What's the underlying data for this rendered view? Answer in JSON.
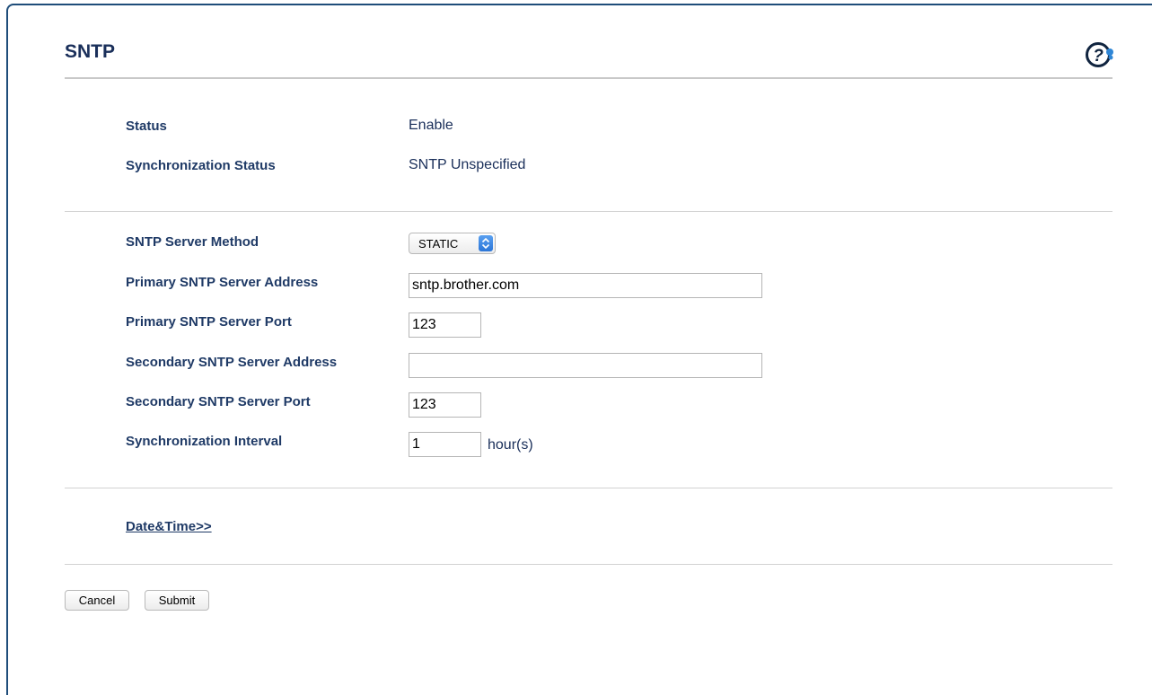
{
  "page": {
    "title": "SNTP"
  },
  "status_section": {
    "status_label": "Status",
    "status_value": "Enable",
    "sync_status_label": "Synchronization Status",
    "sync_status_value": "SNTP Unspecified"
  },
  "settings": {
    "server_method_label": "SNTP Server Method",
    "server_method_value": "STATIC",
    "primary_address_label": "Primary SNTP Server Address",
    "primary_address_value": "sntp.brother.com",
    "primary_port_label": "Primary SNTP Server Port",
    "primary_port_value": "123",
    "secondary_address_label": "Secondary SNTP Server Address",
    "secondary_address_value": "",
    "secondary_port_label": "Secondary SNTP Server Port",
    "secondary_port_value": "123",
    "interval_label": "Synchronization Interval",
    "interval_value": "1",
    "interval_unit": "hour(s)"
  },
  "links": {
    "date_time": "Date&Time>>"
  },
  "buttons": {
    "cancel": "Cancel",
    "submit": "Submit"
  },
  "colors": {
    "frame": "#1f4d7a",
    "heading": "#1a2f5a",
    "select_accent": "#2c76d8"
  }
}
